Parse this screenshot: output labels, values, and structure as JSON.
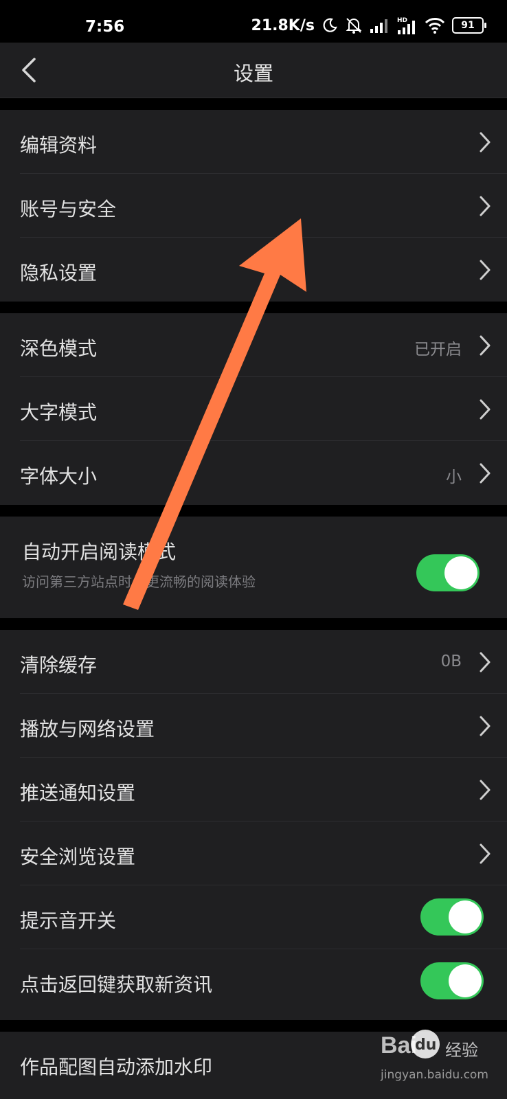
{
  "status_bar": {
    "time": "7:56",
    "network_speed": "21.8K/s",
    "battery": "91",
    "icons": [
      "moon-icon",
      "alarm-off-icon",
      "signal-icon",
      "hd-signal-icon",
      "wifi-icon",
      "battery-icon"
    ]
  },
  "header": {
    "title": "设置",
    "back_icon": "chevron-left-icon"
  },
  "groups": {
    "account": [
      {
        "label": "编辑资料"
      },
      {
        "label": "账号与安全"
      },
      {
        "label": "隐私设置"
      }
    ],
    "display": [
      {
        "label": "深色模式",
        "value": "已开启"
      },
      {
        "label": "大字模式"
      },
      {
        "label": "字体大小",
        "value": "小"
      }
    ],
    "reading": {
      "label": "自动开启阅读模式",
      "sublabel": "访问第三方站点时，更流畅的阅读体验",
      "toggle_on": true
    },
    "misc": [
      {
        "label": "清除缓存",
        "value": "0B"
      },
      {
        "label": "播放与网络设置"
      },
      {
        "label": "推送通知设置"
      },
      {
        "label": "安全浏览设置"
      },
      {
        "label": "提示音开关",
        "toggle_on": true
      },
      {
        "label": "点击返回键获取新资讯",
        "toggle_on": true
      }
    ],
    "last": [
      {
        "label": "作品配图自动添加水印"
      }
    ]
  },
  "watermark": {
    "brand": "Bai",
    "brand_paw": "du",
    "sub": "经验",
    "url": "jingyan.baidu.com"
  },
  "colors": {
    "background": "#000000",
    "surface": "#1f1f21",
    "toggle_on": "#34c759",
    "annotation_arrow": "#ff7a45"
  }
}
